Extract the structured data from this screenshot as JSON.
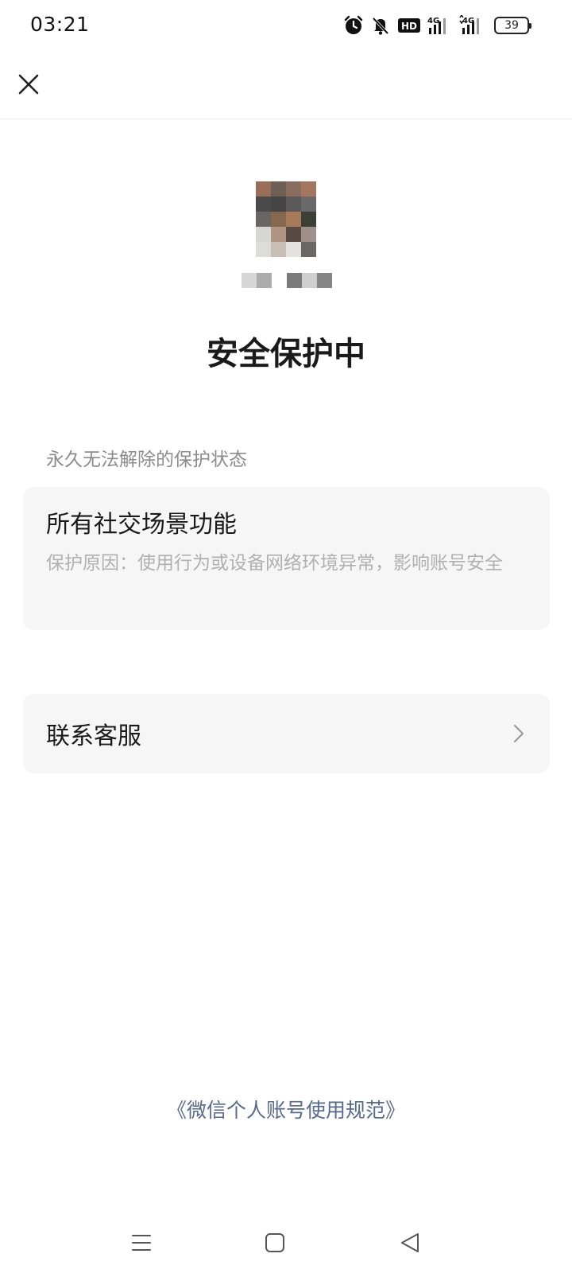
{
  "status_bar": {
    "time": "03:21",
    "battery_level": "39",
    "icons": [
      "alarm-icon",
      "mute-bell-icon",
      "hd-icon",
      "signal-4g-icon",
      "signal-4g-icon",
      "battery-icon"
    ]
  },
  "nav": {
    "close_icon": "close-icon"
  },
  "header": {
    "title": "安全保护中"
  },
  "restriction": {
    "section_label": "永久无法解除的保护状态",
    "title": "所有社交场景功能",
    "description": "保护原因：使用行为或设备网络环境异常，影响账号安全"
  },
  "support": {
    "label": "联系客服",
    "chevron_icon": "chevron-right-icon"
  },
  "footer": {
    "policy_link": "《微信个人账号使用规范》",
    "link_color": "#56698f"
  },
  "system_nav": {
    "menu_icon": "menu-icon",
    "home_icon": "home-icon",
    "back_icon": "back-icon"
  }
}
